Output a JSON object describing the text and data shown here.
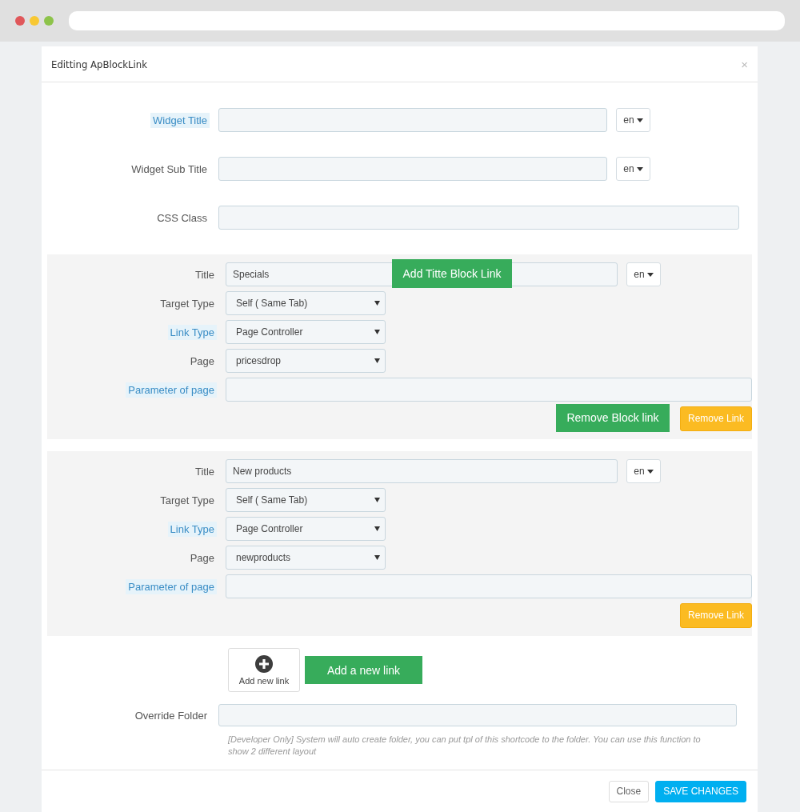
{
  "dialog": {
    "title": "Editting ApBlockLink",
    "close": "×"
  },
  "fields": [
    {
      "kind": "text",
      "label": "Widget Title",
      "highlighted": true,
      "lang": "en"
    },
    {
      "kind": "text",
      "label": "Widget Sub Title",
      "highlighted": false,
      "lang": "en"
    },
    {
      "kind": "text",
      "label": "CSS Class",
      "highlighted": false
    }
  ],
  "blocks": [
    {
      "callout": "Add Titte Block Link",
      "fields": [
        {
          "kind": "text",
          "label": "Title",
          "highlighted": false,
          "value": "Specials",
          "lang": "en"
        },
        {
          "kind": "select",
          "label": "Target Type",
          "highlighted": false,
          "value": "Self ( Same Tab)"
        },
        {
          "kind": "select",
          "label": "Link Type",
          "highlighted": true,
          "value": "Page Controller"
        },
        {
          "kind": "select",
          "label": "Page",
          "highlighted": false,
          "value": "pricesdrop"
        },
        {
          "kind": "text",
          "label": "Parameter of page",
          "highlighted": true
        }
      ],
      "actions": [
        {
          "kind": "callout",
          "label": "Remove Block link"
        },
        {
          "kind": "button",
          "label": "Remove Link"
        }
      ]
    },
    {
      "fields": [
        {
          "kind": "text",
          "label": "Title",
          "highlighted": false,
          "value": "New products",
          "lang": "en"
        },
        {
          "kind": "select",
          "label": "Target Type",
          "highlighted": false,
          "value": "Self ( Same Tab)"
        },
        {
          "kind": "select",
          "label": "Link Type",
          "highlighted": true,
          "value": "Page Controller"
        },
        {
          "kind": "select",
          "label": "Page",
          "highlighted": false,
          "value": "newproducts"
        },
        {
          "kind": "text",
          "label": "Parameter of page",
          "highlighted": true
        }
      ],
      "actions": [
        {
          "kind": "button",
          "label": "Remove Link"
        }
      ]
    }
  ],
  "add_link": {
    "label": "Add new link",
    "callout": "Add a new link"
  },
  "override": {
    "label": "Override Folder",
    "help": "[Developer Only] System will auto create folder, you can put tpl of this shortcode to the folder. You can use this function to show 2 different layout"
  },
  "footer": {
    "buttons": [
      {
        "kind": "default",
        "label": "Close"
      },
      {
        "kind": "primary",
        "label": "SAVE CHANGES"
      }
    ]
  }
}
